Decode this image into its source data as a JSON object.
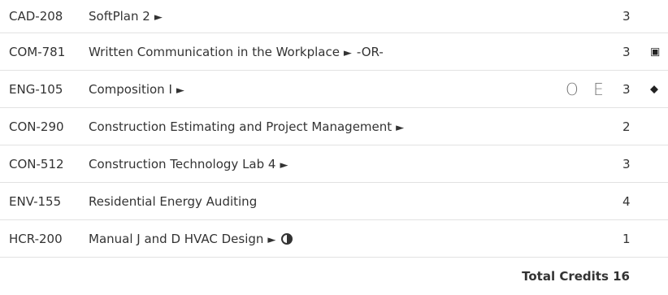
{
  "courses": [
    {
      "code": "CAD-208",
      "title": "SoftPlan 2",
      "arrow": "►",
      "credits": "3"
    },
    {
      "code": "COM-781",
      "title": "Written Communication in the Workplace",
      "arrow": "►",
      "suffix": "-OR-",
      "credits": "3",
      "icon": "▣"
    },
    {
      "code": "ENG-105",
      "title": "Composition I",
      "arrow": "►",
      "flags": "O E",
      "credits": "3",
      "icon": "◆"
    },
    {
      "code": "CON-290",
      "title": "Construction Estimating and Project Management",
      "arrow": "►",
      "credits": "2"
    },
    {
      "code": "CON-512",
      "title": "Construction Technology Lab 4",
      "arrow": "►",
      "credits": "3"
    },
    {
      "code": "ENV-155",
      "title": "Residential Energy Auditing",
      "credits": "4"
    },
    {
      "code": "HCR-200",
      "title": "Manual J and D HVAC Design",
      "arrow": "►",
      "credits": "1"
    }
  ],
  "total": {
    "label": "Total Credits 16"
  }
}
